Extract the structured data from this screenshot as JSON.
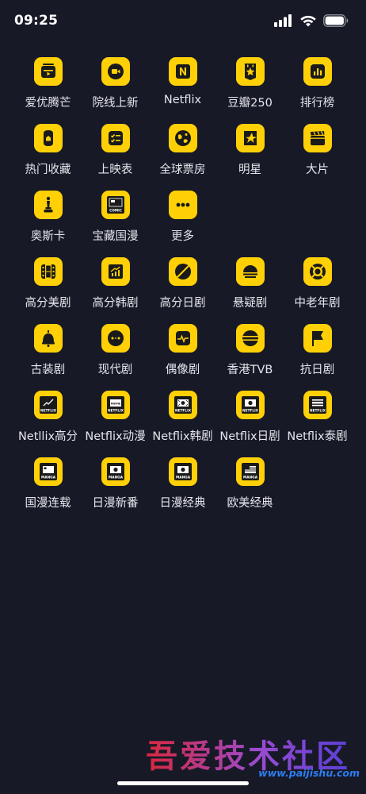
{
  "status_bar": {
    "time": "09:25"
  },
  "colors": {
    "background": "#171927",
    "icon_bg": "#FFD006",
    "icon_fg": "#1A1A1A",
    "label": "#E5E6EC"
  },
  "grid": {
    "rows": [
      [
        {
          "label": "爱优腾芒",
          "icon": "tv-stack-icon"
        },
        {
          "label": "院线上新",
          "icon": "camera-icon"
        },
        {
          "label": "Netflix",
          "icon": "netflix-n-icon"
        },
        {
          "label": "豆瓣250",
          "icon": "star-ribbon-icon"
        },
        {
          "label": "排行榜",
          "icon": "bar-chart-icon"
        }
      ],
      [
        {
          "label": "热门收藏",
          "icon": "bookmark-box-icon"
        },
        {
          "label": "上映表",
          "icon": "checklist-icon"
        },
        {
          "label": "全球票房",
          "icon": "globe-icon"
        },
        {
          "label": "明星",
          "icon": "star-sparkle-icon"
        },
        {
          "label": "大片",
          "icon": "clapperboard-icon"
        }
      ],
      [
        {
          "label": "奥斯卡",
          "icon": "oscar-statue-icon"
        },
        {
          "label": "宝藏国漫",
          "icon": "comic-icon",
          "badge": "COMIC"
        },
        {
          "label": "更多",
          "icon": "more-dots-icon"
        }
      ],
      [
        {
          "label": "高分美剧",
          "icon": "film-strip-icon"
        },
        {
          "label": "高分韩剧",
          "icon": "trend-chart-icon"
        },
        {
          "label": "高分日剧",
          "icon": "planet-slash-icon"
        },
        {
          "label": "悬疑剧",
          "icon": "sunset-icon"
        },
        {
          "label": "中老年剧",
          "icon": "lifebuoy-icon"
        }
      ],
      [
        {
          "label": "古装剧",
          "icon": "bell-icon"
        },
        {
          "label": "现代剧",
          "icon": "face-icon"
        },
        {
          "label": "偶像剧",
          "icon": "heartbeat-icon"
        },
        {
          "label": "香港TVB",
          "icon": "striped-circle-icon"
        },
        {
          "label": "抗日剧",
          "icon": "flag-icon"
        }
      ],
      [
        {
          "label": "Netllix高分",
          "icon": "netflix-trend-icon",
          "badge": "NETFLIX"
        },
        {
          "label": "Netflix动漫",
          "icon": "netflix-anime-icon",
          "badge": "NETFLIX"
        },
        {
          "label": "Netflix韩剧",
          "icon": "netflix-korea-icon",
          "badge": "NETFLIX"
        },
        {
          "label": "Netflix日剧",
          "icon": "netflix-japan-icon",
          "badge": "NETFLIX"
        },
        {
          "label": "Netflix泰剧",
          "icon": "netflix-thai-icon",
          "badge": "NETFLIX"
        }
      ],
      [
        {
          "label": "国漫连载",
          "icon": "manga-china-icon",
          "badge": "MANGA"
        },
        {
          "label": "日漫新番",
          "icon": "manga-japan-icon",
          "badge": "MANGA"
        },
        {
          "label": "日漫经典",
          "icon": "manga-classic-icon",
          "badge": "MANGA"
        },
        {
          "label": "欧美经典",
          "icon": "manga-us-icon",
          "badge": "MANGA"
        }
      ]
    ]
  },
  "watermark": {
    "text": "吾爱技术社区",
    "url": "www.paijishu.com"
  }
}
